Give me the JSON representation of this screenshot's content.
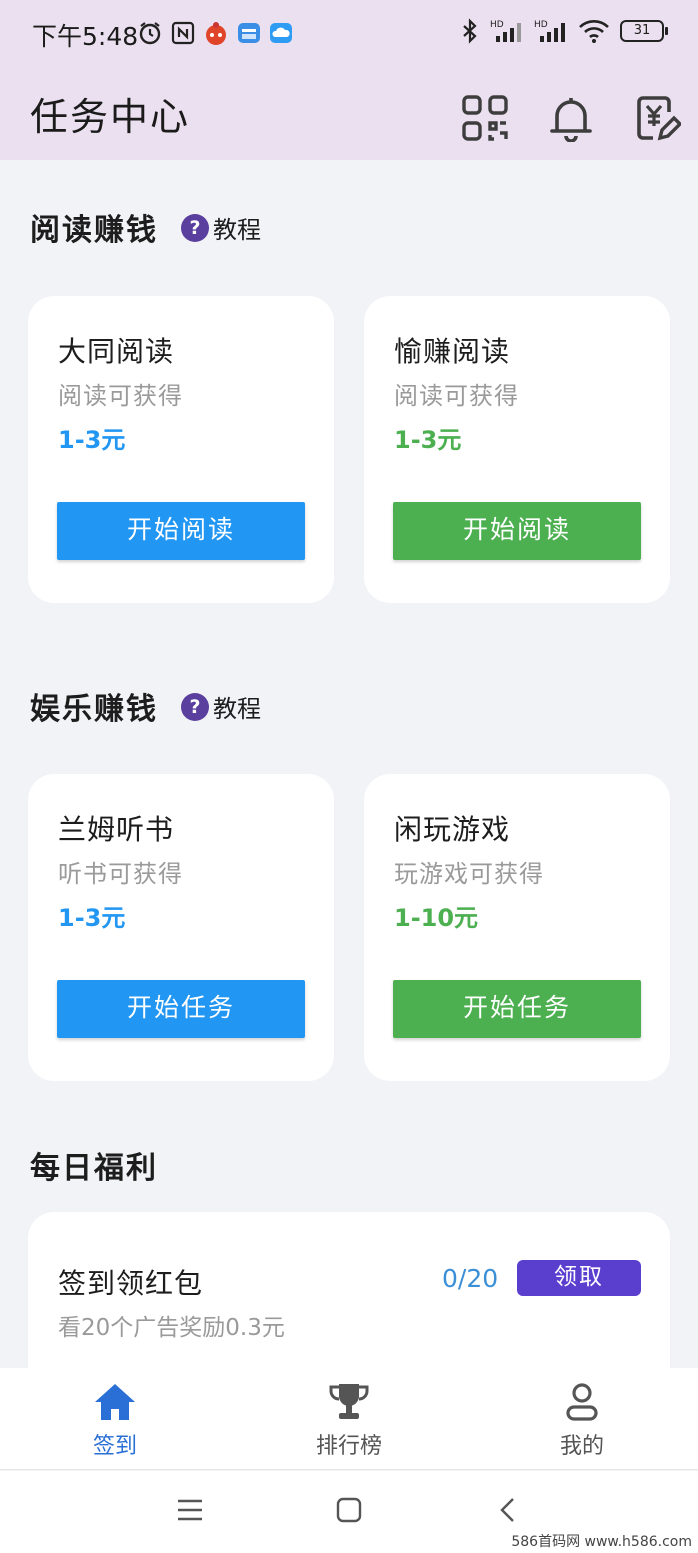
{
  "status_bar": {
    "time": "下午5:48",
    "battery": "31"
  },
  "header": {
    "title": "任务中心"
  },
  "sections": [
    {
      "title": "阅读赚钱",
      "tutorial": "教程",
      "cards": [
        {
          "name": "大同阅读",
          "sub": "阅读可获得",
          "reward": "1-3元",
          "button": "开始阅读"
        },
        {
          "name": "愉赚阅读",
          "sub": "阅读可获得",
          "reward": "1-3元",
          "button": "开始阅读"
        }
      ]
    },
    {
      "title": "娱乐赚钱",
      "tutorial": "教程",
      "cards": [
        {
          "name": "兰姆听书",
          "sub": "听书可获得",
          "reward": "1-3元",
          "button": "开始任务"
        },
        {
          "name": "闲玩游戏",
          "sub": "玩游戏可获得",
          "reward": "1-10元",
          "button": "开始任务"
        }
      ]
    }
  ],
  "daily": {
    "title": "每日福利",
    "task": {
      "name": "签到领红包",
      "desc": "看20个广告奖励0.3元",
      "progress": "0/20",
      "button": "领取"
    }
  },
  "bottom_nav": [
    {
      "label": "签到",
      "icon": "home-icon",
      "active": true
    },
    {
      "label": "排行榜",
      "icon": "trophy-icon",
      "active": false
    },
    {
      "label": "我的",
      "icon": "user-icon",
      "active": false
    }
  ],
  "colors": {
    "blue": "#2196f3",
    "green": "#4caf50",
    "purple": "#5a3fcf",
    "nav_active": "#2a6fd6",
    "nav_inactive": "#555555"
  },
  "watermark": "586首码网 www.h586.com"
}
